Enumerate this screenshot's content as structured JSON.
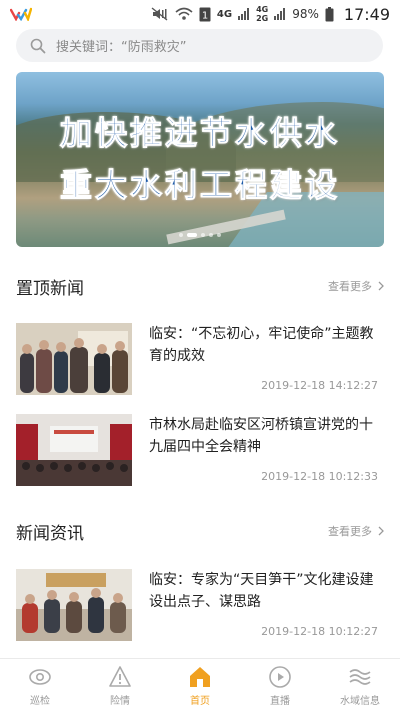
{
  "status_bar": {
    "network_1": "4G",
    "network_2": "4G",
    "network_3": "2G",
    "battery": "98%",
    "time": "17:49"
  },
  "search": {
    "placeholder": "搜关键词：“防雨救灾”"
  },
  "banner": {
    "line1": "加快推进节水供水",
    "line2": "重大水利工程建设",
    "slide_count": 5,
    "active_slide": 1
  },
  "sections": {
    "pinned": {
      "title": "置顶新闻",
      "more": "查看更多"
    },
    "news": {
      "title": "新闻资讯",
      "more": "查看更多"
    }
  },
  "pinned_items": [
    {
      "title": "临安：“不忘初心，牢记使命”主题教育的成效",
      "date": "2019-12-18 14:12:27"
    },
    {
      "title": "市林水局赴临安区河桥镇宣讲党的十九届四中全会精神",
      "date": "2019-12-18 10:12:33"
    }
  ],
  "news_items": [
    {
      "title": "临安：专家为“天目笋干”文化建设建设出点子、谋思路",
      "date": "2019-12-18 10:12:27"
    }
  ],
  "tabs": [
    {
      "label": "巡检",
      "icon": "eye-icon"
    },
    {
      "label": "险情",
      "icon": "warning-icon"
    },
    {
      "label": "首页",
      "icon": "home-icon",
      "active": true
    },
    {
      "label": "直播",
      "icon": "play-icon"
    },
    {
      "label": "水域信息",
      "icon": "water-waves-icon"
    }
  ],
  "colors": {
    "accent": "#f0a020",
    "banner_text": "#1d5aa8",
    "muted": "#999999"
  }
}
